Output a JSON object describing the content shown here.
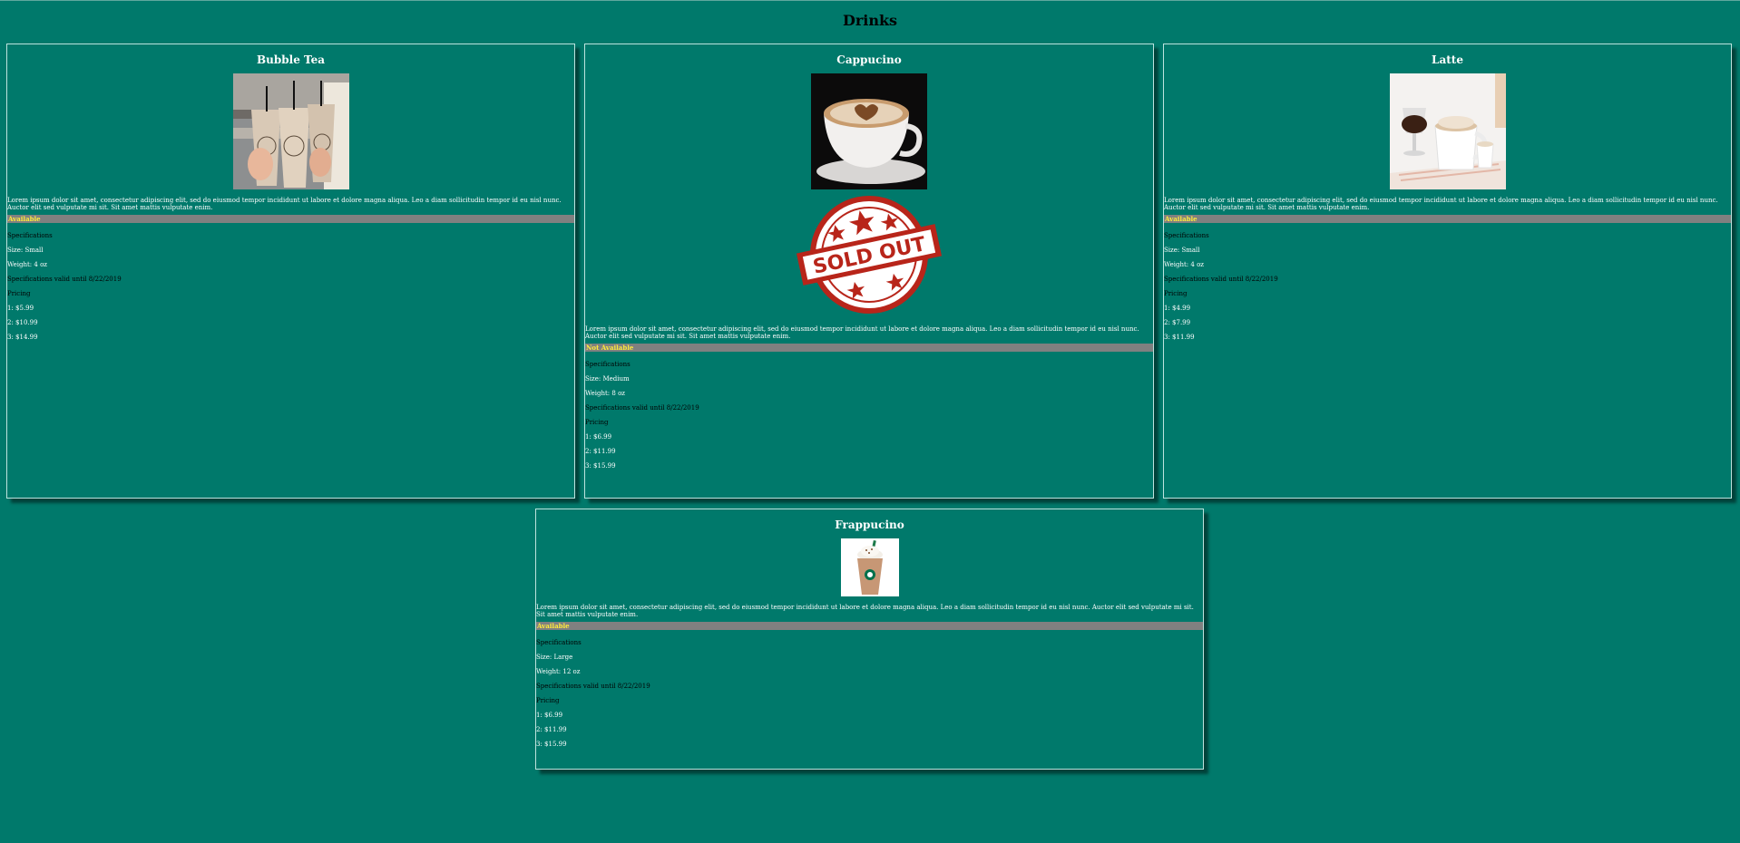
{
  "page": {
    "title": "Drinks"
  },
  "description": "Lorem ipsum dolor sit amet, consectetur adipiscing elit, sed do eiusmod tempor incididunt ut labore et dolore magna aliqua. Leo a diam sollicitudin tempor id eu nisl nunc. Auctor elit sed vulputate mi sit. Sit amet mattis vulputate enim.",
  "colors": {
    "background": "#00796b",
    "status_bar": "#808080",
    "status_text": "#ffeb3b",
    "card_border": "#bde3de"
  },
  "products": [
    {
      "name": "Bubble Tea",
      "image": "bubble-tea-photo",
      "status": "Available",
      "spec_heading": "Specifications",
      "size": "Size: Small",
      "weight": "Weight: 4 oz",
      "valid": "Specifications valid until 8/22/2019",
      "pricing_heading": "Pricing",
      "prices": [
        "1: $5.99",
        "2: $10.99",
        "3: $14.99"
      ]
    },
    {
      "name": "Cappucino",
      "image": "cappucino-photo",
      "status": "Not Available",
      "stamp": "SOLD OUT",
      "spec_heading": "Specifications",
      "size": "Size: Medium",
      "weight": "Weight: 8 oz",
      "valid": "Specifications valid until 8/22/2019",
      "pricing_heading": "Pricing",
      "prices": [
        "1: $6.99",
        "2: $11.99",
        "3: $15.99"
      ]
    },
    {
      "name": "Latte",
      "image": "latte-photo",
      "status": "Available",
      "spec_heading": "Specifications",
      "size": "Size: Small",
      "weight": "Weight: 4 oz",
      "valid": "Specifications valid until 8/22/2019",
      "pricing_heading": "Pricing",
      "prices": [
        "1: $4.99",
        "2: $7.99",
        "3: $11.99"
      ]
    },
    {
      "name": "Frappucino",
      "image": "frappucino-photo",
      "status": "Available",
      "spec_heading": "Specifications",
      "size": "Size: Large",
      "weight": "Weight: 12 oz",
      "valid": "Specifications valid until 8/22/2019",
      "pricing_heading": "Pricing",
      "prices": [
        "1: $6.99",
        "2: $11.99",
        "3: $15.99"
      ]
    }
  ]
}
